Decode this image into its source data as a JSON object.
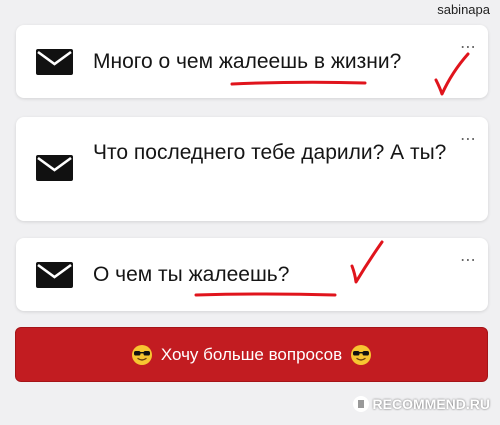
{
  "watermark_top": "sabinapa",
  "watermark_bottom": "RECOMMEND.RU",
  "questions": [
    {
      "text": "Много о чем жалеешь в жизни?",
      "menu": "⋯"
    },
    {
      "text": "Что последнего тебе дарили? А ты?",
      "menu": "⋯"
    },
    {
      "text": "О чем ты жалеешь?",
      "menu": "⋯"
    }
  ],
  "more_button": {
    "label": "Хочу больше вопросов"
  },
  "colors": {
    "button_red": "#c21c21",
    "annotation_red": "#e0141c",
    "background": "#f0f0f2",
    "card": "#ffffff"
  },
  "icons": {
    "question": "envelope-icon",
    "menu": "more-dots-icon",
    "button_left": "sunglasses-emoji-icon",
    "button_right": "sunglasses-emoji-icon"
  }
}
